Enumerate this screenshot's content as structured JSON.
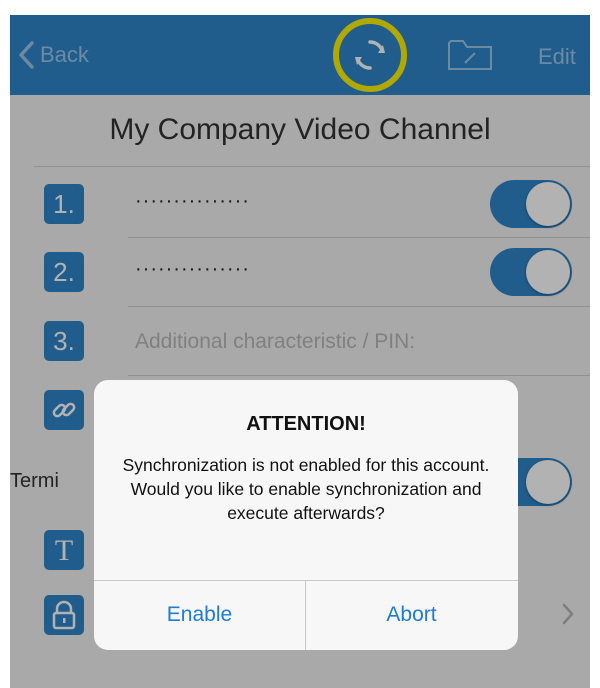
{
  "navbar": {
    "back_label": "Back",
    "edit_label": "Edit",
    "sync_icon": "sync-icon",
    "folder_icon": "folder-edit-icon",
    "highlight_color": "#fff200",
    "bar_color": "#2f86c9"
  },
  "page": {
    "title": "My Company Video Channel"
  },
  "fields": [
    {
      "badge": "1.",
      "value": "···············",
      "toggle_on": true
    },
    {
      "badge": "2.",
      "value": "···············",
      "toggle_on": true
    },
    {
      "badge": "3.",
      "placeholder": "Additional characteristic / PIN:"
    }
  ],
  "rows": {
    "link_icon": "link-icon",
    "terminal_label": "Termi",
    "text_icon": "text-icon",
    "lock_icon": "lock-icon"
  },
  "dialog": {
    "title": "ATTENTION!",
    "message": "Synchronization is not enabled for this account. Would you like to enable synchronization and execute afterwards?",
    "buttons": [
      "Enable",
      "Abort"
    ],
    "button_color": "#1f7ad8"
  }
}
